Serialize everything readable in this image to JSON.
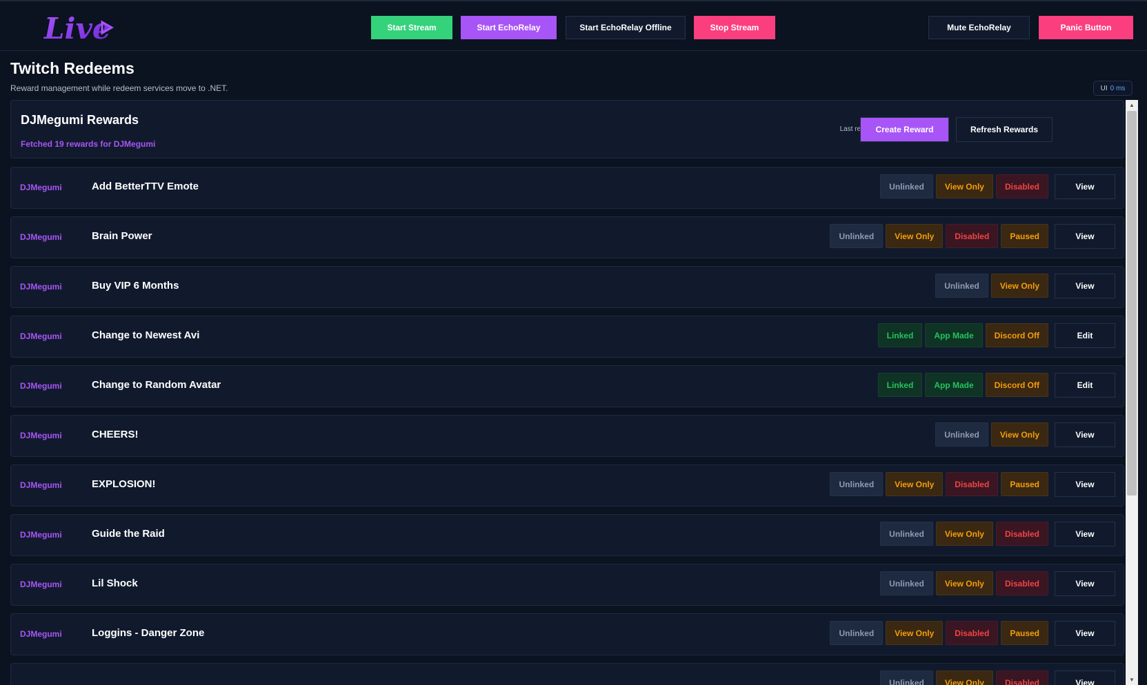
{
  "header": {
    "logo_text": "Live",
    "buttons": [
      {
        "label": "Start Stream",
        "style": "green"
      },
      {
        "label": "Start EchoRelay",
        "style": "purple"
      },
      {
        "label": "Start EchoRelay Offline",
        "style": "dark"
      },
      {
        "label": "Stop Stream",
        "style": "pink"
      },
      {
        "label": "Mute EchoRelay",
        "style": "dark"
      },
      {
        "label": "Panic Button",
        "style": "pink"
      }
    ]
  },
  "page": {
    "title": "Twitch Redeems",
    "subtitle": "Reward management while redeem services move to .NET.",
    "latency_label": "UI",
    "latency_value": "0 ms"
  },
  "rewards_panel": {
    "title": "DJMegumi Rewards",
    "status": "Fetched 19 rewards for DJMegumi",
    "last_refresh": "Last refresh: never",
    "create_label": "Create Reward",
    "refresh_label": "Refresh Rewards"
  },
  "rewards": [
    {
      "owner": "DJMegumi",
      "name": "Add BetterTTV Emote",
      "badges": [
        "Unlinked",
        "View Only",
        "Disabled"
      ],
      "action": "View"
    },
    {
      "owner": "DJMegumi",
      "name": "Brain Power",
      "badges": [
        "Unlinked",
        "View Only",
        "Disabled",
        "Paused"
      ],
      "action": "View"
    },
    {
      "owner": "DJMegumi",
      "name": "Buy VIP 6 Months",
      "badges": [
        "Unlinked",
        "View Only"
      ],
      "action": "View"
    },
    {
      "owner": "DJMegumi",
      "name": "Change to Newest Avi",
      "badges": [
        "Linked",
        "App Made",
        "Discord Off"
      ],
      "action": "Edit"
    },
    {
      "owner": "DJMegumi",
      "name": "Change to Random Avatar",
      "badges": [
        "Linked",
        "App Made",
        "Discord Off"
      ],
      "action": "Edit"
    },
    {
      "owner": "DJMegumi",
      "name": "CHEERS!",
      "badges": [
        "Unlinked",
        "View Only"
      ],
      "action": "View"
    },
    {
      "owner": "DJMegumi",
      "name": "EXPLOSION!",
      "badges": [
        "Unlinked",
        "View Only",
        "Disabled",
        "Paused"
      ],
      "action": "View"
    },
    {
      "owner": "DJMegumi",
      "name": "Guide the Raid",
      "badges": [
        "Unlinked",
        "View Only",
        "Disabled"
      ],
      "action": "View"
    },
    {
      "owner": "DJMegumi",
      "name": "Lil Shock",
      "badges": [
        "Unlinked",
        "View Only",
        "Disabled"
      ],
      "action": "View"
    },
    {
      "owner": "DJMegumi",
      "name": "Loggins - Danger Zone",
      "badges": [
        "Unlinked",
        "View Only",
        "Disabled",
        "Paused"
      ],
      "action": "View"
    },
    {
      "owner": "",
      "name": "",
      "badges": [
        "Unlinked",
        "View Only",
        "Disabled"
      ],
      "action": "View"
    }
  ],
  "colors": {
    "background": "#0b1220",
    "panel": "#111a2d",
    "accent_purple": "#a855f7",
    "accent_green": "#34d27b",
    "accent_pink": "#fb3f7e"
  }
}
